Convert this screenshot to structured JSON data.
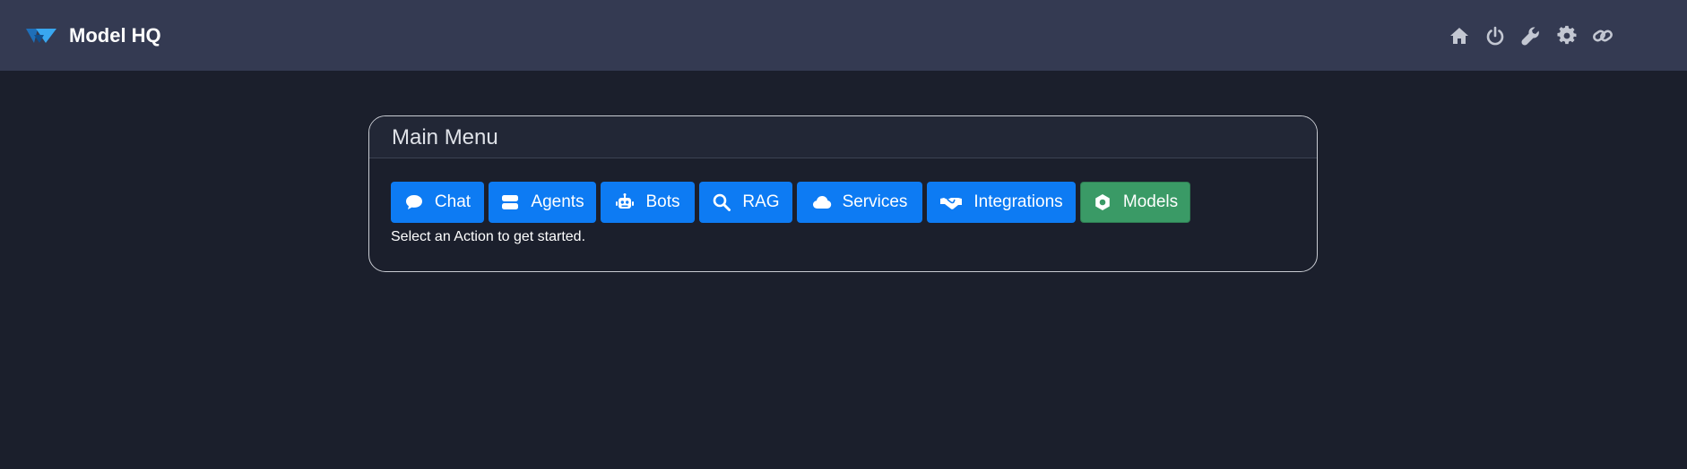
{
  "header": {
    "brand_name": "Model HQ",
    "icons": [
      {
        "name": "home-icon"
      },
      {
        "name": "power-icon"
      },
      {
        "name": "wrench-icon"
      },
      {
        "name": "gear-icon"
      },
      {
        "name": "link-icon"
      }
    ]
  },
  "main_menu": {
    "title": "Main Menu",
    "buttons": [
      {
        "label": "Chat",
        "icon": "chat-bubble-icon",
        "color": "#0d7bf3"
      },
      {
        "label": "Agents",
        "icon": "server-icon",
        "color": "#0d7bf3"
      },
      {
        "label": "Bots",
        "icon": "robot-icon",
        "color": "#0d7bf3"
      },
      {
        "label": "RAG",
        "icon": "search-icon",
        "color": "#0d7bf3"
      },
      {
        "label": "Services",
        "icon": "cloud-icon",
        "color": "#0d7bf3"
      },
      {
        "label": "Integrations",
        "icon": "handshake-icon",
        "color": "#0d7bf3"
      },
      {
        "label": "Models",
        "icon": "cog-icon",
        "color": "#3a9a66"
      }
    ],
    "hint": "Select an Action to get started."
  },
  "colors": {
    "background": "#1b1f2c",
    "topbar": "#343a52",
    "primary": "#0d7bf3",
    "success": "#3a9a66"
  }
}
